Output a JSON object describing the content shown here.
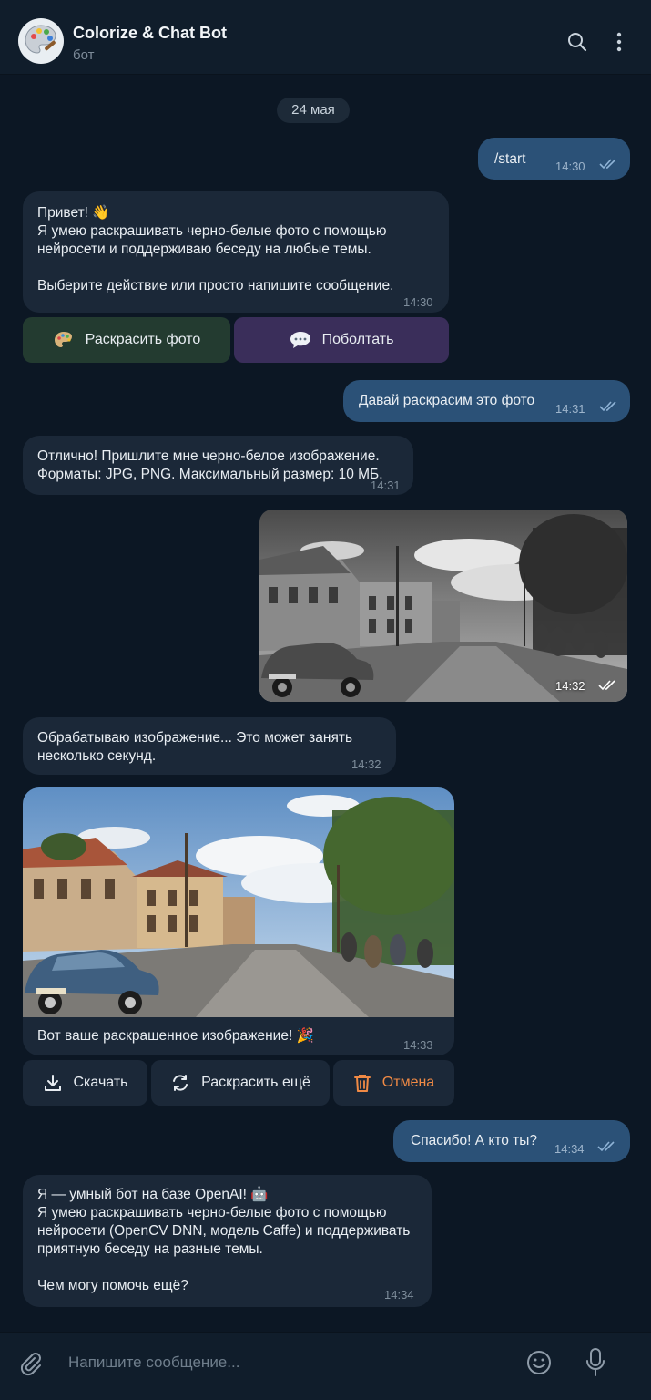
{
  "header": {
    "title": "Colorize & Chat Bot",
    "subtitle": "бот"
  },
  "date_separator": "24 мая",
  "messages": {
    "m1": {
      "text": "/start",
      "time": "14:30"
    },
    "m2": {
      "text": "Привет! 👋\nЯ умею раскрашивать черно-белые фото с помощью\nнейросети и поддерживаю беседу на любые темы.\n\nВыберите действие или просто напишите сообщение.",
      "time": "14:30"
    },
    "m3": {
      "text": "Давай раскрасим это фото",
      "time": "14:31"
    },
    "m4": {
      "text": "Отлично! Пришлите мне черно-белое изображение.\nФорматы: JPG, PNG. Максимальный размер: 10 МБ.",
      "time": "14:31"
    },
    "m5": {
      "time": "14:32"
    },
    "m6": {
      "text": "Обрабатываю изображение... Это может занять\nнесколько секунд.",
      "time": "14:32"
    },
    "m7": {
      "text": "Вот ваше раскрашенное изображение! 🎉",
      "time": "14:33"
    },
    "m8": {
      "text": "Спасибо! А кто ты?",
      "time": "14:34"
    },
    "m9": {
      "text": "Я — умный бот на базе OpenAI! 🤖\nЯ умею раскрашивать черно-белые фото с помощью\nнейросети (OpenCV DNN, модель Caffe) и поддерживать\nприятную беседу на разные темы.\n\nЧем могу помочь ещё?",
      "time": "14:34"
    }
  },
  "keyboard1": {
    "colorize_label": "Раскрасить фото",
    "chat_label": "Поболтать"
  },
  "keyboard2": {
    "download_label": "Скачать",
    "recolor_label": "Раскрасить ещё",
    "cancel_label": "Отмена"
  },
  "composer": {
    "placeholder": "Напишите сообщение..."
  },
  "colors": {
    "background": "#0c1724",
    "incoming_bubble": "#1b2838",
    "outgoing_bubble": "#2b5177",
    "colorize_button": "#233b30",
    "chat_button": "#3a2e5a",
    "cancel_text": "#f08a45"
  }
}
